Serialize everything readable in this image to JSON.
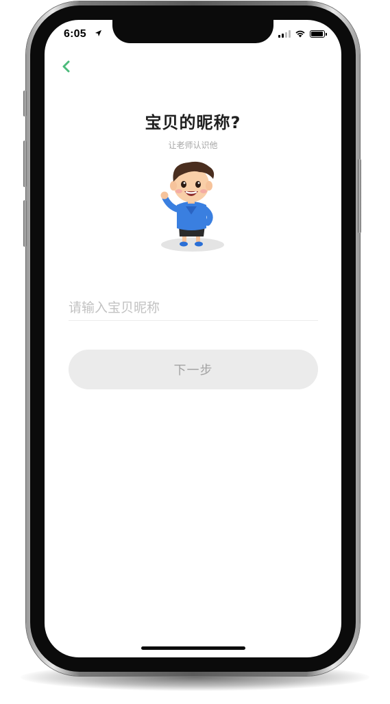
{
  "status_bar": {
    "time": "6:05",
    "icons": [
      "location-arrow-icon",
      "cellular-signal-icon",
      "wifi-icon",
      "battery-icon"
    ],
    "battery_level": 0.85
  },
  "nav": {
    "back_icon": "chevron-left-icon"
  },
  "page": {
    "title": "宝贝的昵称?",
    "subtitle": "让老师认识他"
  },
  "form": {
    "nickname_placeholder": "请输入宝贝昵称",
    "nickname_value": ""
  },
  "actions": {
    "next_label": "下一步"
  },
  "colors": {
    "accent": "#4cbb7b",
    "button_bg": "#ebebeb",
    "button_text": "#a3a3a3",
    "title_text": "#1f1f1f",
    "subtitle_text": "#a6a6a6"
  }
}
